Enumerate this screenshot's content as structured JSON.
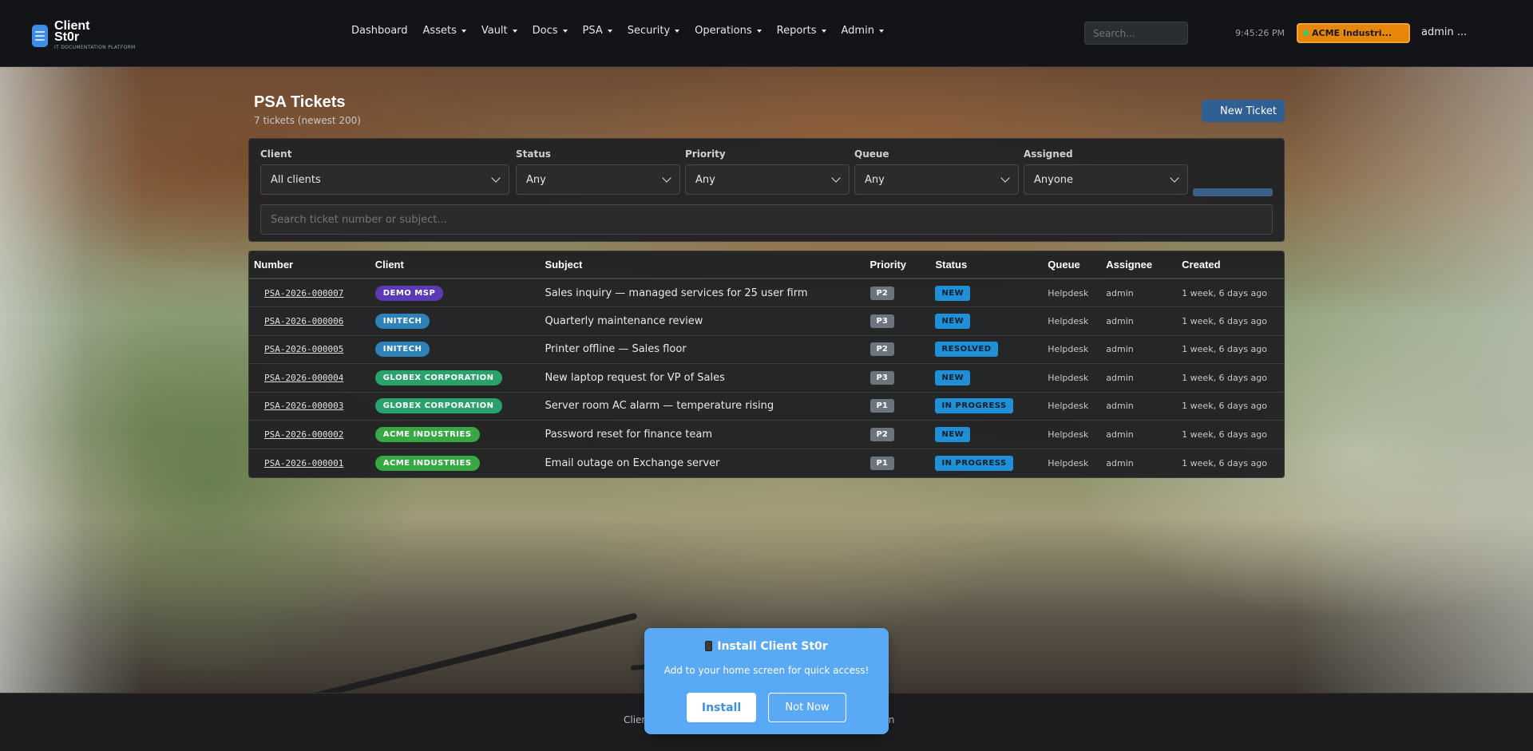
{
  "brand": {
    "name_line1": "Client",
    "name_line2": "St0r",
    "tagline": "IT DOCUMENTATION PLATFORM"
  },
  "nav": {
    "items": [
      {
        "label": "Dashboard",
        "dropdown": false
      },
      {
        "label": "Assets",
        "dropdown": true
      },
      {
        "label": "Vault",
        "dropdown": true
      },
      {
        "label": "Docs",
        "dropdown": true
      },
      {
        "label": "PSA",
        "dropdown": true
      },
      {
        "label": "Security",
        "dropdown": true
      },
      {
        "label": "Operations",
        "dropdown": true
      },
      {
        "label": "Reports",
        "dropdown": true
      },
      {
        "label": "Admin",
        "dropdown": true
      }
    ],
    "search_placeholder": "Search...",
    "time": "9:45:26 PM",
    "client_selector": "ACME Industri...",
    "user": "admin ..."
  },
  "page": {
    "title": "PSA Tickets",
    "subtitle": "7 tickets (newest 200)",
    "new_button": "New Ticket"
  },
  "filters": {
    "client": {
      "label": "Client",
      "value": "All clients"
    },
    "status": {
      "label": "Status",
      "value": "Any"
    },
    "priority": {
      "label": "Priority",
      "value": "Any"
    },
    "queue": {
      "label": "Queue",
      "value": "Any"
    },
    "assigned": {
      "label": "Assigned",
      "value": "Anyone"
    },
    "search_placeholder": "Search ticket number or subject..."
  },
  "table": {
    "headers": [
      "Number",
      "Client",
      "Subject",
      "Priority",
      "Status",
      "Queue",
      "Assignee",
      "Created"
    ],
    "rows": [
      {
        "number": "PSA-2026-000007",
        "client": "DEMO MSP",
        "client_color": "#5b3bb5",
        "subject": "Sales inquiry — managed services for 25 user firm",
        "priority": "P2",
        "status": "NEW",
        "queue": "Helpdesk",
        "assignee": "admin",
        "created": "1 week, 6 days ago"
      },
      {
        "number": "PSA-2026-000006",
        "client": "INITECH",
        "client_color": "#2f82b8",
        "subject": "Quarterly maintenance review",
        "priority": "P3",
        "status": "NEW",
        "queue": "Helpdesk",
        "assignee": "admin",
        "created": "1 week, 6 days ago"
      },
      {
        "number": "PSA-2026-000005",
        "client": "INITECH",
        "client_color": "#2f82b8",
        "subject": "Printer offline — Sales floor",
        "priority": "P2",
        "status": "RESOLVED",
        "queue": "Helpdesk",
        "assignee": "admin",
        "created": "1 week, 6 days ago"
      },
      {
        "number": "PSA-2026-000004",
        "client": "GLOBEX CORPORATION",
        "client_color": "#2aa26b",
        "subject": "New laptop request for VP of Sales",
        "priority": "P3",
        "status": "NEW",
        "queue": "Helpdesk",
        "assignee": "admin",
        "created": "1 week, 6 days ago"
      },
      {
        "number": "PSA-2026-000003",
        "client": "GLOBEX CORPORATION",
        "client_color": "#2aa26b",
        "subject": "Server room AC alarm — temperature rising",
        "priority": "P1",
        "status": "IN PROGRESS",
        "queue": "Helpdesk",
        "assignee": "admin",
        "created": "1 week, 6 days ago"
      },
      {
        "number": "PSA-2026-000002",
        "client": "ACME INDUSTRIES",
        "client_color": "#38a845",
        "subject": "Password reset for finance team",
        "priority": "P2",
        "status": "NEW",
        "queue": "Helpdesk",
        "assignee": "admin",
        "created": "1 week, 6 days ago"
      },
      {
        "number": "PSA-2026-000001",
        "client": "ACME INDUSTRIES",
        "client_color": "#38a845",
        "subject": "Email outage on Exchange server",
        "priority": "P1",
        "status": "IN PROGRESS",
        "queue": "Helpdesk",
        "assignee": "admin",
        "created": "1 week, 6 days ago"
      }
    ]
  },
  "footer": {
    "left": "Clien",
    "right": "ation"
  },
  "install": {
    "title": "Install Client St0r",
    "text": "Add to your home screen for quick access!",
    "install_button": "Install",
    "dismiss_button": "Not Now"
  }
}
